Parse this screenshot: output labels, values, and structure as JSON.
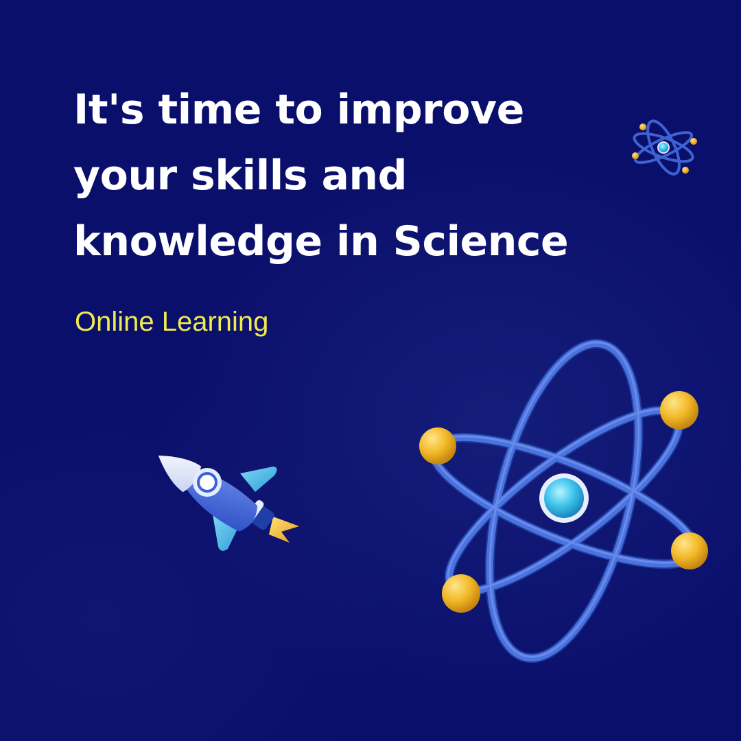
{
  "headline": {
    "line1": "It's time to improve",
    "line2": "your skills and",
    "line3": "knowledge in Science"
  },
  "subtitle": "Online Learning",
  "colors": {
    "background": "#0a0f6b",
    "headline": "#ffffff",
    "subtitle": "#f1ea4f",
    "orbit": "#3e63d1",
    "electron": "#f3b928",
    "nucleus": "#3cc3ea"
  },
  "icons": [
    "atom-icon",
    "rocket-icon"
  ]
}
